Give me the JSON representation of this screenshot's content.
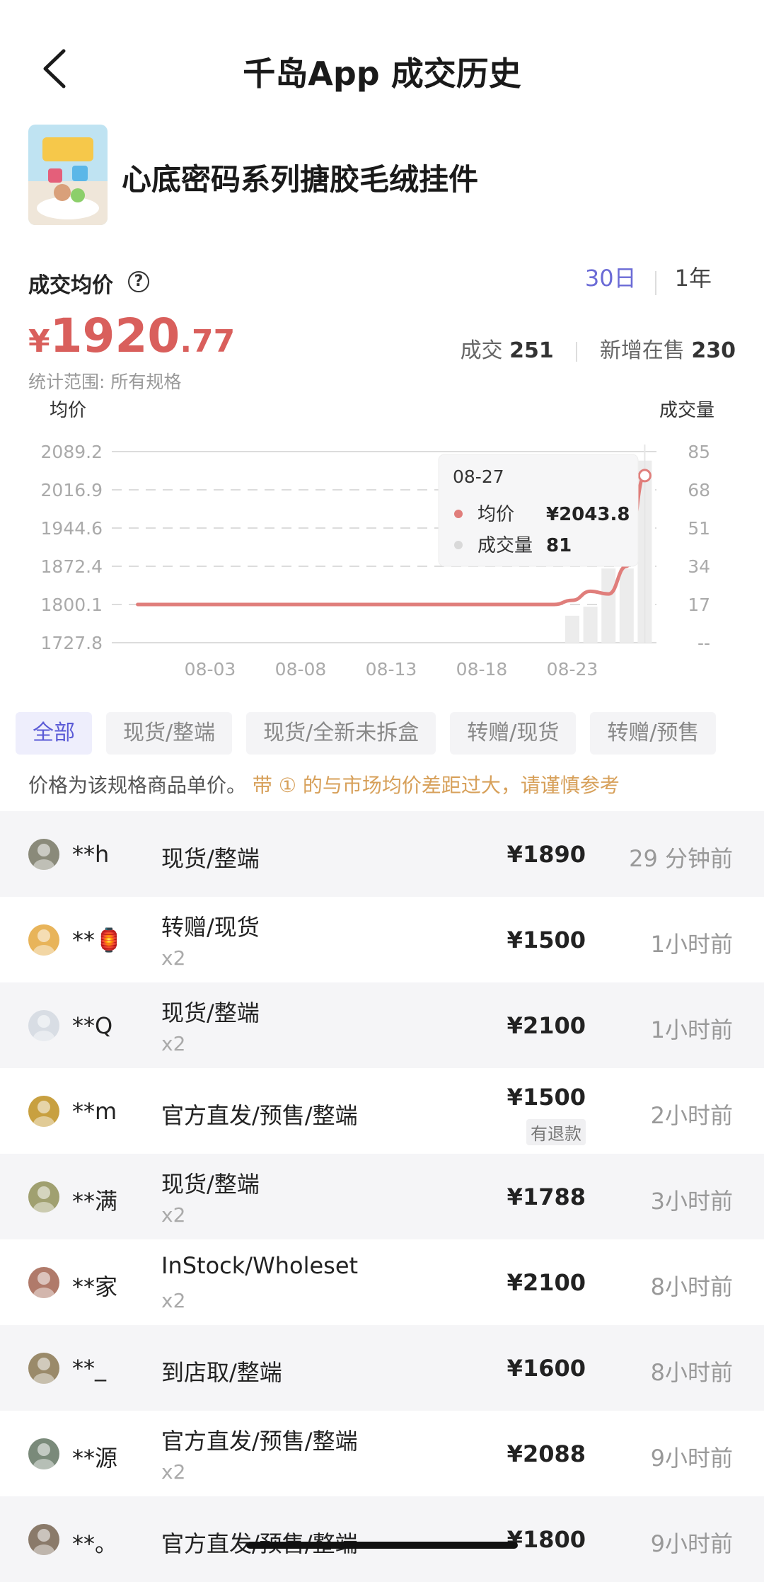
{
  "header": {
    "title": "千岛App 成交历史"
  },
  "product": {
    "name": "心底密码系列搪胶毛绒挂件"
  },
  "summary": {
    "avg_label": "成交均价",
    "help": "?",
    "ranges": [
      "30日",
      "1年"
    ],
    "active_range": "30日",
    "currency": "¥",
    "avg_int": "1920",
    "avg_dec": ".77",
    "deals_label": "成交",
    "deals_value": "251",
    "new_label": "新增在售",
    "new_value": "230",
    "scope": "统计范围: 所有规格"
  },
  "chart_data": {
    "type": "line",
    "left_axis_label": "均价",
    "right_axis_label": "成交量",
    "y_ticks": [
      "2089.2",
      "2016.9",
      "1944.6",
      "1872.4",
      "1800.1",
      "1727.8"
    ],
    "y2_ticks": [
      "85",
      "68",
      "51",
      "34",
      "17",
      "--"
    ],
    "x_ticks": [
      "08-03",
      "08-08",
      "08-13",
      "08-18",
      "08-23"
    ],
    "ylim": [
      1727.8,
      2089.2
    ],
    "y2lim": [
      0,
      85
    ],
    "line_color": "#e07e7b",
    "bar_color": "#ececec",
    "price_series": [
      {
        "x": "07-30",
        "y": 1800.1
      },
      {
        "x": "08-22",
        "y": 1800.1
      },
      {
        "x": "08-23",
        "y": 1808
      },
      {
        "x": "08-24",
        "y": 1825
      },
      {
        "x": "08-25",
        "y": 1820
      },
      {
        "x": "08-26",
        "y": 1872.4
      },
      {
        "x": "08-27",
        "y": 2043.8
      }
    ],
    "volume_series": [
      {
        "x": "08-23",
        "y": 12
      },
      {
        "x": "08-24",
        "y": 16
      },
      {
        "x": "08-25",
        "y": 33
      },
      {
        "x": "08-26",
        "y": 33
      },
      {
        "x": "08-27",
        "y": 81
      }
    ],
    "tooltip": {
      "date": "08-27",
      "price_label": "均价",
      "price_value": "¥2043.8",
      "volume_label": "成交量",
      "volume_value": "81"
    }
  },
  "filters": [
    "全部",
    "现货/整端",
    "现货/全新未拆盒",
    "转赠/现货",
    "转赠/预售"
  ],
  "active_filter": "全部",
  "note": {
    "text": "价格为该规格商品单价。",
    "warn": "带 ① 的与市场均价差距过大，请谨慎参考"
  },
  "transactions": [
    {
      "user": "**h",
      "spec": "现货/整端",
      "qty": "",
      "price": "¥1890",
      "tag": "",
      "time": "29 分钟前"
    },
    {
      "user": "**🏮",
      "spec": "转赠/现货",
      "qty": "x2",
      "price": "¥1500",
      "tag": "",
      "time": "1小时前"
    },
    {
      "user": "**Q",
      "spec": "现货/整端",
      "qty": "x2",
      "price": "¥2100",
      "tag": "",
      "time": "1小时前"
    },
    {
      "user": "**m",
      "spec": "官方直发/预售/整端",
      "qty": "",
      "price": "¥1500",
      "tag": "有退款",
      "time": "2小时前"
    },
    {
      "user": "**满",
      "spec": "现货/整端",
      "qty": "x2",
      "price": "¥1788",
      "tag": "",
      "time": "3小时前"
    },
    {
      "user": "**家",
      "spec": "InStock/Wholeset",
      "qty": "x2",
      "price": "¥2100",
      "tag": "",
      "time": "8小时前"
    },
    {
      "user": "**_",
      "spec": "到店取/整端",
      "qty": "",
      "price": "¥1600",
      "tag": "",
      "time": "8小时前"
    },
    {
      "user": "**源",
      "spec": "官方直发/预售/整端",
      "qty": "x2",
      "price": "¥2088",
      "tag": "",
      "time": "9小时前"
    },
    {
      "user": "**。",
      "spec": "官方直发/预售/整端",
      "qty": "",
      "price": "¥1800",
      "tag": "",
      "time": "9小时前"
    }
  ],
  "colors": {
    "accent": "#5b5bd6",
    "price": "#d95f5c",
    "warning": "#d7a05a"
  }
}
